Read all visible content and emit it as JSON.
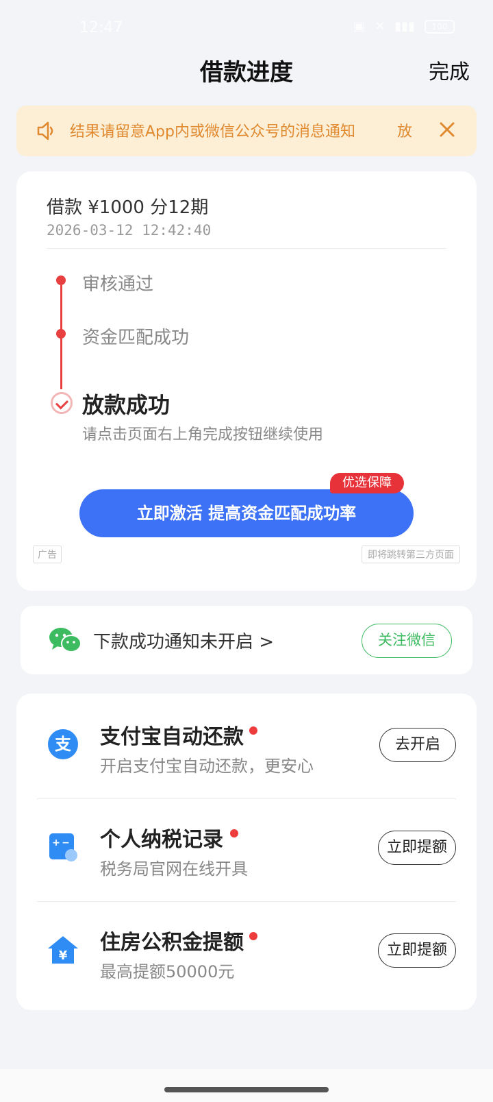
{
  "status_bar": {
    "time": "12:47",
    "battery": "100"
  },
  "header": {
    "title": "借款进度",
    "done_label": "完成"
  },
  "notice": {
    "text": "结果请留意App内或微信公众号的消息通知",
    "trailing_fragment": "放"
  },
  "loan": {
    "summary": "借款 ¥1000   分12期",
    "time": "2026-03-12 12:42:40"
  },
  "progress": {
    "steps": [
      {
        "label": "审核通过"
      },
      {
        "label": "资金匹配成功"
      }
    ],
    "final": {
      "label": "放款成功",
      "sub": "请点击页面右上角完成按钮继续使用"
    }
  },
  "promo": {
    "button_label": "立即激活 提高资金匹配成功率",
    "badge": "优选保障",
    "ad_tag": "广告",
    "ad_note": "即将跳转第三方页面"
  },
  "wechat": {
    "text": "下款成功通知未开启 >",
    "follow_label": "关注微信"
  },
  "services": [
    {
      "icon": "alipay-icon",
      "title": "支付宝自动还款",
      "sub": "开启支付宝自动还款，更安心",
      "button": "去开启"
    },
    {
      "icon": "tax-calculator-icon",
      "title": "个人纳税记录",
      "sub": "税务局官网在线开具",
      "button": "立即提额"
    },
    {
      "icon": "housing-fund-icon",
      "title": "住房公积金提额",
      "sub": "最高提额50000元",
      "button": "立即提额"
    }
  ],
  "colors": {
    "primary_blue": "#3d72f6",
    "accent_red": "#e84040",
    "wechat_green": "#3dbb60",
    "notice_bg": "#fdeed6",
    "notice_text": "#e0892e"
  }
}
